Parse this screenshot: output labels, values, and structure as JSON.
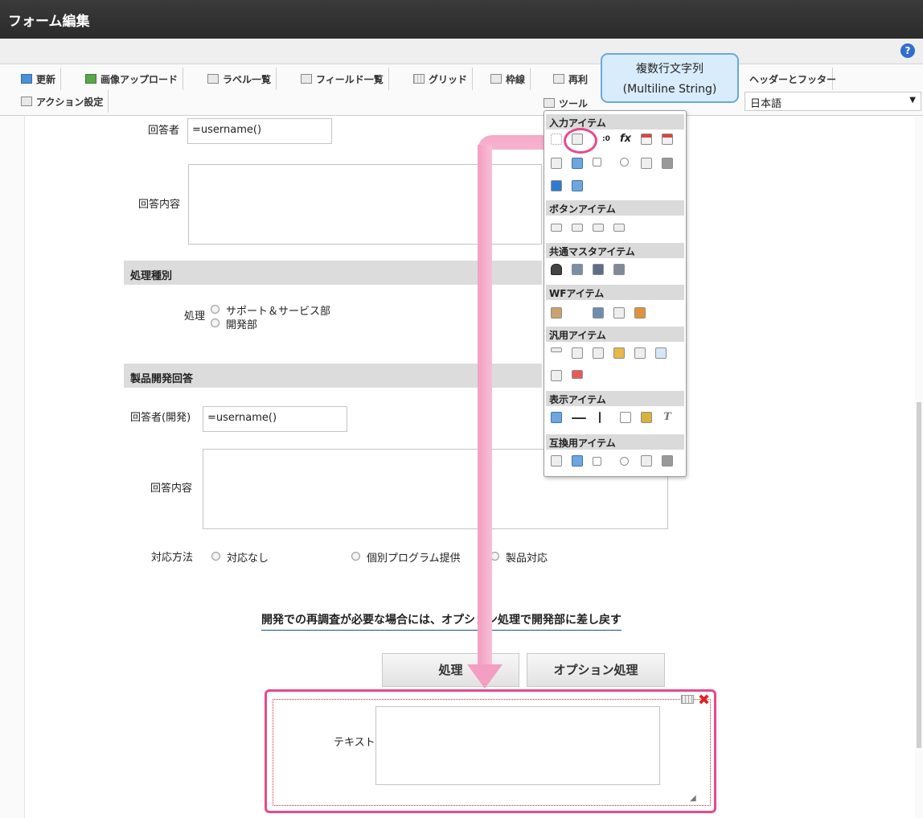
{
  "window": {
    "title": "フォーム編集",
    "help_icon": "?"
  },
  "toolbar": {
    "items": [
      {
        "label": "更新",
        "icon": "refresh-icon"
      },
      {
        "label": "画像アップロード",
        "icon": "image-upload-icon"
      },
      {
        "label": "ラベル一覧",
        "icon": "list-icon"
      },
      {
        "label": "フィールド一覧",
        "icon": "list-icon"
      },
      {
        "label": "グリッド",
        "icon": "grid-icon"
      },
      {
        "label": "枠線",
        "icon": "border-icon"
      },
      {
        "label": "再利",
        "icon": "reuse-icon"
      },
      {
        "label": "ヘッダーとフッター",
        "icon": ""
      }
    ],
    "action_settings": "アクション設定",
    "tools": "ツール",
    "language": "日本語"
  },
  "tooltip": {
    "line1": "複数行文字列",
    "line2": "(Multiline String)"
  },
  "form": {
    "respondent_label": "回答者",
    "respondent_value": "=username()",
    "response_content_label": "回答内容",
    "section_processing": "処理種別",
    "processing_label": "処理",
    "processing_options": [
      "サポート＆サービス部",
      "開発部"
    ],
    "section_product_dev": "製品開発回答",
    "dev_respondent_label": "回答者(開発)",
    "dev_respondent_value": "=username()",
    "dev_response_content_label": "回答内容",
    "handling_label": "対応方法",
    "handling_options": [
      "対応なし",
      "個別プログラム提供",
      "製品対応"
    ],
    "note_text": "開発での再調査が必要な場合には、オプション処理で開発部に差し戻す",
    "process_button": "処理",
    "option_button": "オプション処理",
    "new_field_label": "テキスト"
  },
  "palette": {
    "sections": [
      "入力アイテム",
      "ボタンアイテム",
      "共通マスタアイテム",
      "WFアイテム",
      "汎用アイテム",
      "表示アイテム",
      "互換用アイテム"
    ],
    "fx_label": "fx"
  },
  "colors": {
    "highlight": "#e64a8c",
    "titlebar": "#2b2b2b",
    "tooltip_bg": "#d9ecfb"
  }
}
